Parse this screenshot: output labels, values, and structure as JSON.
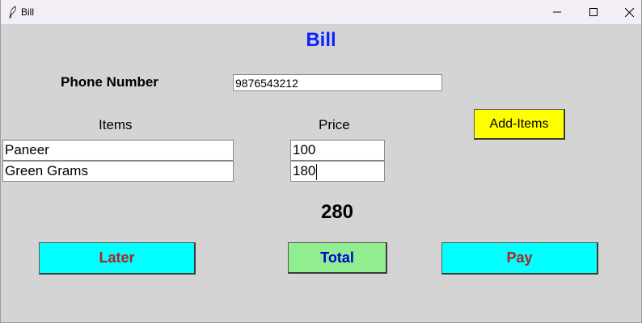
{
  "window": {
    "title": "Bill",
    "icons": {
      "app": "feather-icon",
      "minimize": "minimize-icon",
      "maximize": "maximize-icon",
      "close": "close-icon"
    }
  },
  "form": {
    "heading": "Bill",
    "phone_label": "Phone Number",
    "phone_value": "9876543212",
    "items_header": "Items",
    "price_header": "Price",
    "add_items_label": "Add-Items",
    "rows": [
      {
        "item": "Paneer",
        "price": "100"
      },
      {
        "item": "Green Grams",
        "price": "180"
      }
    ],
    "total": "280",
    "buttons": {
      "later": "Later",
      "total": "Total",
      "pay": "Pay"
    }
  },
  "colors": {
    "heading": "#0b24ff",
    "later_bg": "#00ffff",
    "pay_bg": "#00ffff",
    "total_bg": "#90ee90",
    "add_items_bg": "#ffff00",
    "danger_text": "#b22222",
    "total_text": "#0000cd"
  }
}
